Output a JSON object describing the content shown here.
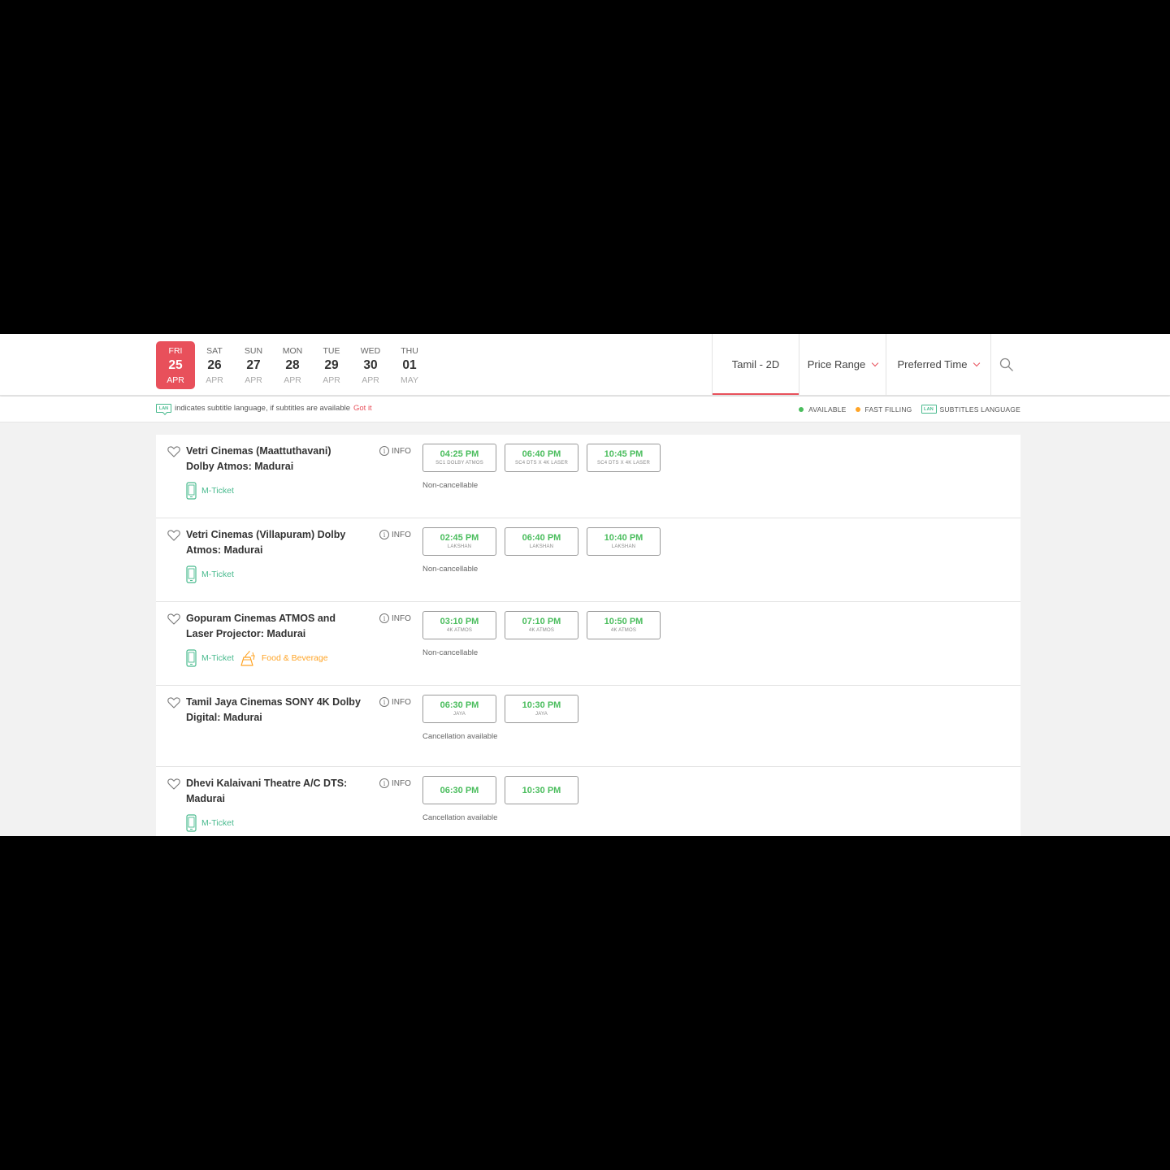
{
  "dates": [
    {
      "dow": "FRI",
      "day": "25",
      "month": "APR",
      "active": true
    },
    {
      "dow": "SAT",
      "day": "26",
      "month": "APR",
      "active": false
    },
    {
      "dow": "SUN",
      "day": "27",
      "month": "APR",
      "active": false
    },
    {
      "dow": "MON",
      "day": "28",
      "month": "APR",
      "active": false
    },
    {
      "dow": "TUE",
      "day": "29",
      "month": "APR",
      "active": false
    },
    {
      "dow": "WED",
      "day": "30",
      "month": "APR",
      "active": false
    },
    {
      "dow": "THU",
      "day": "01",
      "month": "MAY",
      "active": false
    }
  ],
  "filters": {
    "language": "Tamil - 2D",
    "price": "Price Range",
    "time": "Preferred Time"
  },
  "legend": {
    "lan_badge": "LAN",
    "subtitle_note": "indicates subtitle language, if subtitles are available",
    "got_it": "Got it",
    "available": "AVAILABLE",
    "fast_filling": "FAST FILLING",
    "subtitles_language": "SUBTITLES LANGUAGE"
  },
  "colors": {
    "accent": "#e8505b",
    "available": "#4abd5d",
    "fast_filling": "#ffa426",
    "mticket": "#49ba8e"
  },
  "info_label": "INFO",
  "cinemas": [
    {
      "name": "Vetri Cinemas (Maattuthavani) Dolby Atmos: Madurai",
      "amenities": [
        {
          "icon": "mobile-ticket-icon",
          "label": "M-Ticket"
        }
      ],
      "shows": [
        {
          "time": "04:25 PM",
          "screen": "SC1 DOLBY ATMOS"
        },
        {
          "time": "06:40 PM",
          "screen": "SC4 DTS X 4K LASER"
        },
        {
          "time": "10:45 PM",
          "screen": "SC4 DTS X 4K LASER"
        }
      ],
      "cancellation": "Non-cancellable"
    },
    {
      "name": "Vetri Cinemas (Villapuram) Dolby Atmos: Madurai",
      "amenities": [
        {
          "icon": "mobile-ticket-icon",
          "label": "M-Ticket"
        }
      ],
      "shows": [
        {
          "time": "02:45 PM",
          "screen": "LAKSHAN"
        },
        {
          "time": "06:40 PM",
          "screen": "LAKSHAN"
        },
        {
          "time": "10:40 PM",
          "screen": "LAKSHAN"
        }
      ],
      "cancellation": "Non-cancellable"
    },
    {
      "name": "Gopuram Cinemas ATMOS and Laser Projector: Madurai",
      "amenities": [
        {
          "icon": "mobile-ticket-icon",
          "label": "M-Ticket"
        },
        {
          "icon": "food-beverage-icon",
          "label": "Food & Beverage"
        }
      ],
      "shows": [
        {
          "time": "03:10 PM",
          "screen": "4K ATMOS"
        },
        {
          "time": "07:10 PM",
          "screen": "4K ATMOS"
        },
        {
          "time": "10:50 PM",
          "screen": "4K ATMOS"
        }
      ],
      "cancellation": "Non-cancellable"
    },
    {
      "name": "Tamil Jaya Cinemas SONY 4K Dolby Digital: Madurai",
      "amenities": [],
      "shows": [
        {
          "time": "06:30 PM",
          "screen": "JAYA"
        },
        {
          "time": "10:30 PM",
          "screen": "JAYA"
        }
      ],
      "cancellation": "Cancellation available"
    },
    {
      "name": "Dhevi Kalaivani Theatre A/C DTS: Madurai",
      "amenities": [
        {
          "icon": "mobile-ticket-icon",
          "label": "M-Ticket"
        }
      ],
      "shows": [
        {
          "time": "06:30 PM",
          "screen": ""
        },
        {
          "time": "10:30 PM",
          "screen": ""
        }
      ],
      "cancellation": "Cancellation available"
    }
  ]
}
